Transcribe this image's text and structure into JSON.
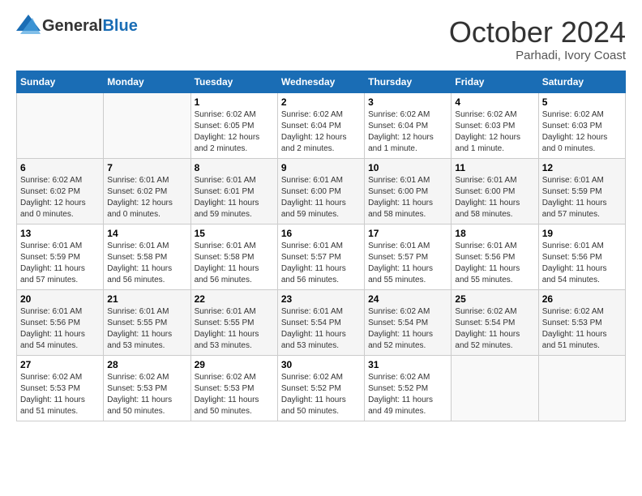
{
  "logo": {
    "text_general": "General",
    "text_blue": "Blue"
  },
  "header": {
    "month": "October 2024",
    "location": "Parhadi, Ivory Coast"
  },
  "weekdays": [
    "Sunday",
    "Monday",
    "Tuesday",
    "Wednesday",
    "Thursday",
    "Friday",
    "Saturday"
  ],
  "weeks": [
    [
      {
        "day": "",
        "info": ""
      },
      {
        "day": "",
        "info": ""
      },
      {
        "day": "1",
        "info": "Sunrise: 6:02 AM\nSunset: 6:05 PM\nDaylight: 12 hours and 2 minutes."
      },
      {
        "day": "2",
        "info": "Sunrise: 6:02 AM\nSunset: 6:04 PM\nDaylight: 12 hours and 2 minutes."
      },
      {
        "day": "3",
        "info": "Sunrise: 6:02 AM\nSunset: 6:04 PM\nDaylight: 12 hours and 1 minute."
      },
      {
        "day": "4",
        "info": "Sunrise: 6:02 AM\nSunset: 6:03 PM\nDaylight: 12 hours and 1 minute."
      },
      {
        "day": "5",
        "info": "Sunrise: 6:02 AM\nSunset: 6:03 PM\nDaylight: 12 hours and 0 minutes."
      }
    ],
    [
      {
        "day": "6",
        "info": "Sunrise: 6:02 AM\nSunset: 6:02 PM\nDaylight: 12 hours and 0 minutes."
      },
      {
        "day": "7",
        "info": "Sunrise: 6:01 AM\nSunset: 6:02 PM\nDaylight: 12 hours and 0 minutes."
      },
      {
        "day": "8",
        "info": "Sunrise: 6:01 AM\nSunset: 6:01 PM\nDaylight: 11 hours and 59 minutes."
      },
      {
        "day": "9",
        "info": "Sunrise: 6:01 AM\nSunset: 6:00 PM\nDaylight: 11 hours and 59 minutes."
      },
      {
        "day": "10",
        "info": "Sunrise: 6:01 AM\nSunset: 6:00 PM\nDaylight: 11 hours and 58 minutes."
      },
      {
        "day": "11",
        "info": "Sunrise: 6:01 AM\nSunset: 6:00 PM\nDaylight: 11 hours and 58 minutes."
      },
      {
        "day": "12",
        "info": "Sunrise: 6:01 AM\nSunset: 5:59 PM\nDaylight: 11 hours and 57 minutes."
      }
    ],
    [
      {
        "day": "13",
        "info": "Sunrise: 6:01 AM\nSunset: 5:59 PM\nDaylight: 11 hours and 57 minutes."
      },
      {
        "day": "14",
        "info": "Sunrise: 6:01 AM\nSunset: 5:58 PM\nDaylight: 11 hours and 56 minutes."
      },
      {
        "day": "15",
        "info": "Sunrise: 6:01 AM\nSunset: 5:58 PM\nDaylight: 11 hours and 56 minutes."
      },
      {
        "day": "16",
        "info": "Sunrise: 6:01 AM\nSunset: 5:57 PM\nDaylight: 11 hours and 56 minutes."
      },
      {
        "day": "17",
        "info": "Sunrise: 6:01 AM\nSunset: 5:57 PM\nDaylight: 11 hours and 55 minutes."
      },
      {
        "day": "18",
        "info": "Sunrise: 6:01 AM\nSunset: 5:56 PM\nDaylight: 11 hours and 55 minutes."
      },
      {
        "day": "19",
        "info": "Sunrise: 6:01 AM\nSunset: 5:56 PM\nDaylight: 11 hours and 54 minutes."
      }
    ],
    [
      {
        "day": "20",
        "info": "Sunrise: 6:01 AM\nSunset: 5:56 PM\nDaylight: 11 hours and 54 minutes."
      },
      {
        "day": "21",
        "info": "Sunrise: 6:01 AM\nSunset: 5:55 PM\nDaylight: 11 hours and 53 minutes."
      },
      {
        "day": "22",
        "info": "Sunrise: 6:01 AM\nSunset: 5:55 PM\nDaylight: 11 hours and 53 minutes."
      },
      {
        "day": "23",
        "info": "Sunrise: 6:01 AM\nSunset: 5:54 PM\nDaylight: 11 hours and 53 minutes."
      },
      {
        "day": "24",
        "info": "Sunrise: 6:02 AM\nSunset: 5:54 PM\nDaylight: 11 hours and 52 minutes."
      },
      {
        "day": "25",
        "info": "Sunrise: 6:02 AM\nSunset: 5:54 PM\nDaylight: 11 hours and 52 minutes."
      },
      {
        "day": "26",
        "info": "Sunrise: 6:02 AM\nSunset: 5:53 PM\nDaylight: 11 hours and 51 minutes."
      }
    ],
    [
      {
        "day": "27",
        "info": "Sunrise: 6:02 AM\nSunset: 5:53 PM\nDaylight: 11 hours and 51 minutes."
      },
      {
        "day": "28",
        "info": "Sunrise: 6:02 AM\nSunset: 5:53 PM\nDaylight: 11 hours and 50 minutes."
      },
      {
        "day": "29",
        "info": "Sunrise: 6:02 AM\nSunset: 5:53 PM\nDaylight: 11 hours and 50 minutes."
      },
      {
        "day": "30",
        "info": "Sunrise: 6:02 AM\nSunset: 5:52 PM\nDaylight: 11 hours and 50 minutes."
      },
      {
        "day": "31",
        "info": "Sunrise: 6:02 AM\nSunset: 5:52 PM\nDaylight: 11 hours and 49 minutes."
      },
      {
        "day": "",
        "info": ""
      },
      {
        "day": "",
        "info": ""
      }
    ]
  ]
}
